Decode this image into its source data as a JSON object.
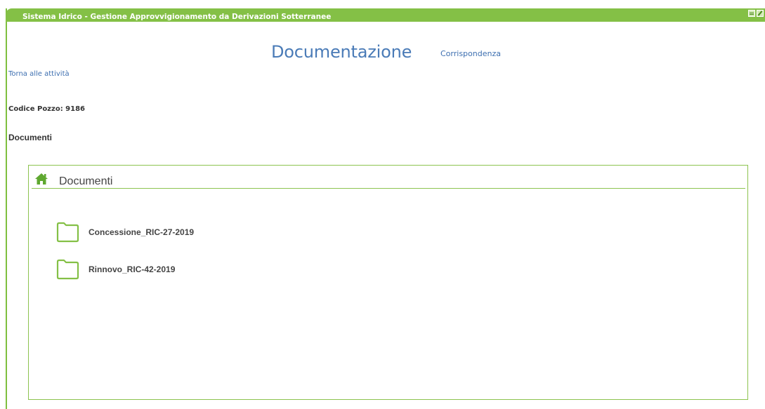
{
  "window": {
    "title": "Sistema Idrico - Gestione Approvvigionamento da Derivazioni Sotterranee",
    "icons": [
      "grid-icon",
      "edit-icon"
    ]
  },
  "page": {
    "heading": "Documentazione",
    "corrispondenza_link": "Corrispondenza",
    "back_link": "Torna alle attività",
    "codice_pozzo": "Codice Pozzo: 9186",
    "section_label": "Documenti"
  },
  "panel": {
    "title": "Documenti",
    "icon": "home-icon",
    "folders": [
      {
        "label": "Concessione_RIC-27-2019",
        "icon": "folder-icon"
      },
      {
        "label": "Rinnovo_RIC-42-2019",
        "icon": "folder-icon"
      }
    ]
  },
  "colors": {
    "accent": "#84c046",
    "border": "#8cc34f",
    "link": "#3d6fb0",
    "heading": "#4a7bb7"
  }
}
